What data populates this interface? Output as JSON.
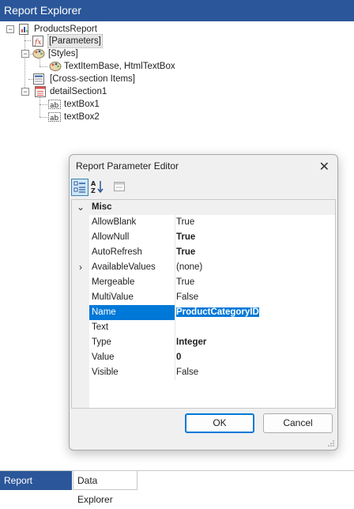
{
  "window": {
    "title": "Report Explorer"
  },
  "tree": {
    "root": "ProductsReport",
    "parameters": "[Parameters]",
    "styles": "[Styles]",
    "style_item": "TextItemBase, HtmlTextBox",
    "cross_section": "[Cross-section Items]",
    "detail": "detailSection1",
    "textbox1": "textBox1",
    "textbox2": "textBox2",
    "icons": {
      "root": "report-icon",
      "parameters": "parameters-icon",
      "styles": "palette-icon",
      "style_item": "palette-icon",
      "cross_section": "section-list-icon",
      "detail": "detail-section-icon",
      "textbox": "textbox-icon"
    }
  },
  "dialog": {
    "title": "Report Parameter Editor",
    "close_glyph": "✕",
    "toolbar": [
      "categorized-icon",
      "alphabetical-icon",
      "property-pages-icon"
    ],
    "category": {
      "expander": "⌄",
      "name": "Misc"
    },
    "properties": [
      {
        "name": "AllowBlank",
        "value": "True",
        "bold": false,
        "expander": ""
      },
      {
        "name": "AllowNull",
        "value": "True",
        "bold": true,
        "expander": ""
      },
      {
        "name": "AutoRefresh",
        "value": "True",
        "bold": true,
        "expander": ""
      },
      {
        "name": "AvailableValues",
        "value": "(none)",
        "bold": false,
        "expander": "›"
      },
      {
        "name": "Mergeable",
        "value": "True",
        "bold": false,
        "expander": ""
      },
      {
        "name": "MultiValue",
        "value": "False",
        "bold": false,
        "expander": ""
      },
      {
        "name": "Name",
        "value": "ProductCategoryID",
        "bold": true,
        "expander": ""
      },
      {
        "name": "Text",
        "value": "",
        "bold": false,
        "expander": ""
      },
      {
        "name": "Type",
        "value": "Integer",
        "bold": true,
        "expander": ""
      },
      {
        "name": "Value",
        "value": "0",
        "bold": true,
        "expander": ""
      },
      {
        "name": "Visible",
        "value": "False",
        "bold": false,
        "expander": ""
      }
    ],
    "ok_label": "OK",
    "cancel_label": "Cancel"
  },
  "tabs": [
    {
      "label": "Report Explorer",
      "active": true
    },
    {
      "label": "Data Explorer",
      "active": false
    }
  ],
  "colors": {
    "accent": "#2b579a",
    "selection": "#0078d7"
  }
}
